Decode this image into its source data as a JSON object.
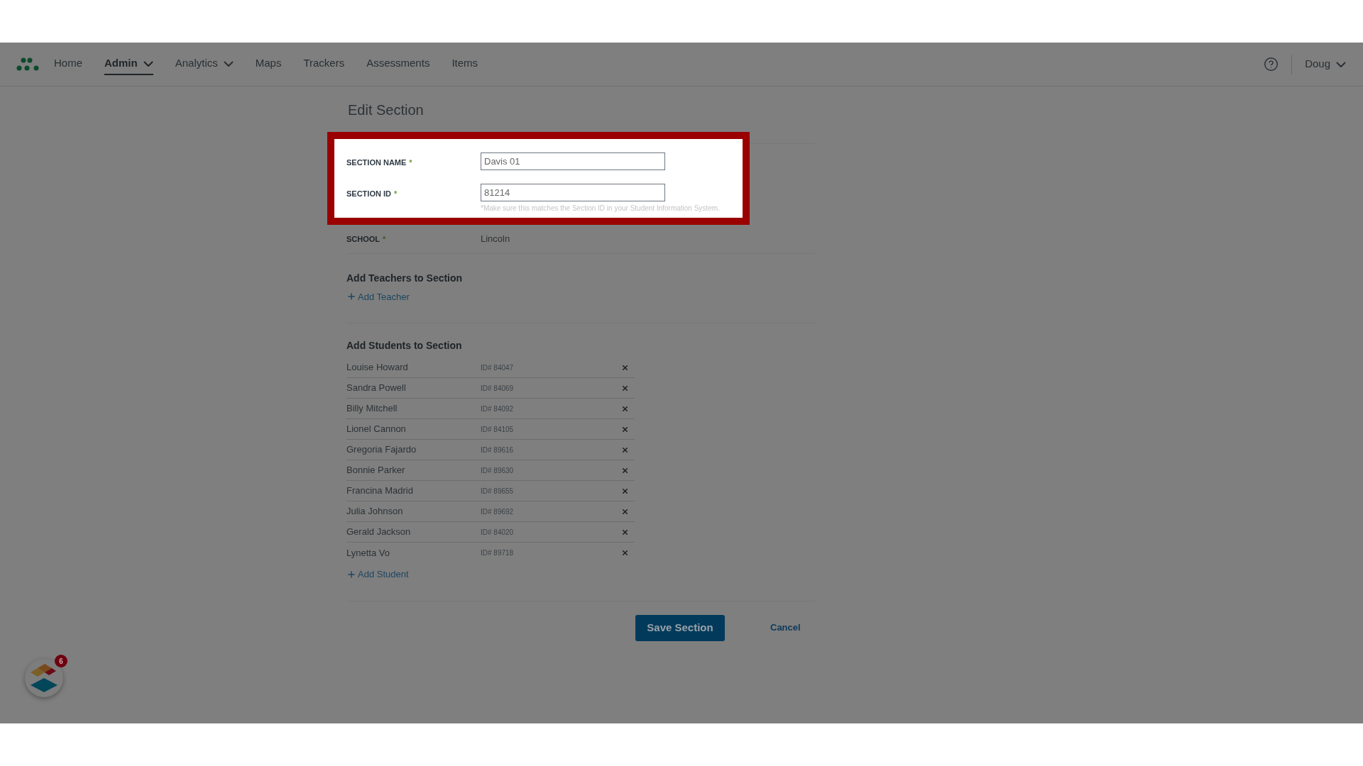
{
  "nav": {
    "items": [
      {
        "label": "Home",
        "selected": false,
        "menu": false
      },
      {
        "label": "Admin",
        "selected": true,
        "menu": true
      },
      {
        "label": "Analytics",
        "selected": false,
        "menu": true
      },
      {
        "label": "Maps",
        "selected": false,
        "menu": false
      },
      {
        "label": "Trackers",
        "selected": false,
        "menu": false
      },
      {
        "label": "Assessments",
        "selected": false,
        "menu": false
      },
      {
        "label": "Items",
        "selected": false,
        "menu": false
      }
    ],
    "user": "Doug"
  },
  "page_title": "Edit Section",
  "highlight": {
    "fields": [
      {
        "label": "SECTION NAME",
        "required": "*",
        "value": "Davis 01"
      },
      {
        "label": "SECTION ID",
        "required": "*",
        "value": "81214",
        "hint": "*Make sure this matches the Section ID in your Student Information System."
      }
    ]
  },
  "school": {
    "label": "SCHOOL",
    "required": "*",
    "value": "Lincoln"
  },
  "teachers": {
    "heading": "Add Teachers to Section",
    "add_link": "Add Teacher"
  },
  "students": {
    "heading": "Add Students to Section",
    "rows": [
      {
        "name": "Louise Howard",
        "id": "ID# 84047"
      },
      {
        "name": "Sandra Powell",
        "id": "ID# 84069"
      },
      {
        "name": "Billy Mitchell",
        "id": "ID# 84092"
      },
      {
        "name": "Lionel Cannon",
        "id": "ID# 84105"
      },
      {
        "name": "Gregoria Fajardo",
        "id": "ID# 89616"
      },
      {
        "name": "Bonnie Parker",
        "id": "ID# 89630"
      },
      {
        "name": "Francina Madrid",
        "id": "ID# 89655"
      },
      {
        "name": "Julia Johnson",
        "id": "ID# 89692"
      },
      {
        "name": "Gerald Jackson",
        "id": "ID# 84020"
      },
      {
        "name": "Lynetta Vo",
        "id": "ID# 89718"
      }
    ],
    "add_link": "Add Student"
  },
  "actions": {
    "save": "Save Section",
    "cancel": "Cancel"
  },
  "launcher": {
    "badge": "6"
  }
}
